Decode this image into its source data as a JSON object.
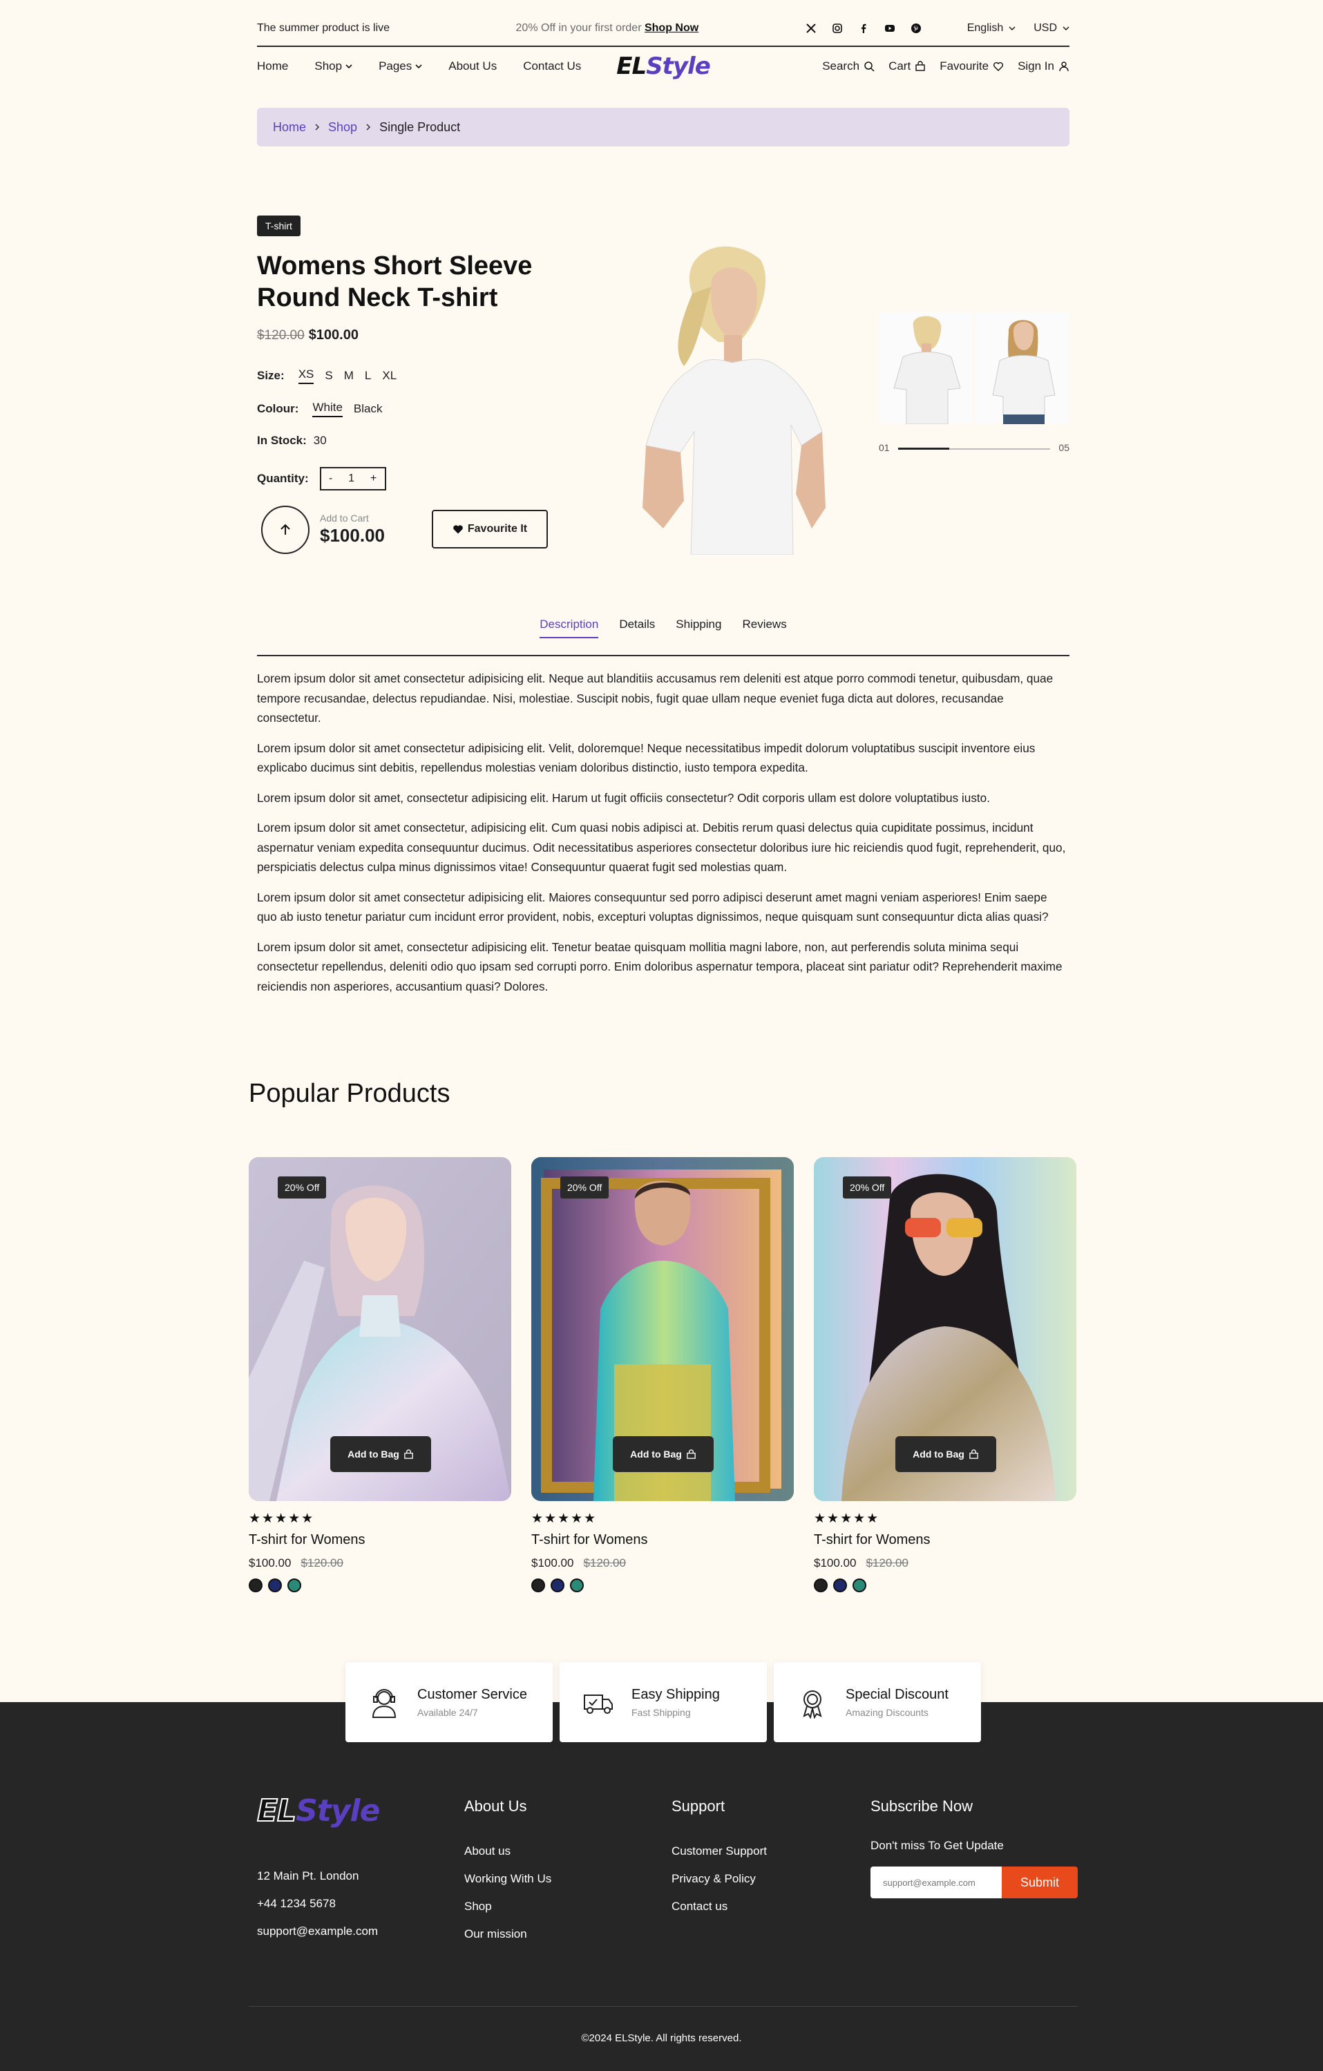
{
  "topbar": {
    "message": "The summer product is live",
    "promo_text": "20% Off in your first order",
    "promo_link": "Shop Now",
    "language": "English",
    "currency": "USD",
    "socials": [
      "x-icon",
      "instagram-icon",
      "facebook-icon",
      "youtube-icon",
      "pinterest-icon"
    ]
  },
  "nav": {
    "items": [
      "Home",
      "Shop",
      "Pages",
      "About Us",
      "Contact Us"
    ],
    "logo_a": "EL",
    "logo_b": "Style",
    "search": "Search",
    "cart": "Cart",
    "favourite": "Favourite",
    "signin": "Sign In"
  },
  "breadcrumb": {
    "home": "Home",
    "shop": "Shop",
    "current": "Single Product"
  },
  "product": {
    "tag": "T-shirt",
    "title": "Womens Short Sleeve Round Neck T-shirt",
    "old_price": "$120.00",
    "price": "$100.00",
    "size_label": "Size:",
    "sizes": [
      "XS",
      "S",
      "M",
      "L",
      "XL"
    ],
    "colour_label": "Colour:",
    "colours": [
      "White",
      "Black"
    ],
    "stock_label": "In Stock:",
    "stock": "30",
    "quantity_label": "Quantity:",
    "quantity": "1",
    "minus": "-",
    "plus": "+",
    "add_to_cart_label": "Add to Cart",
    "add_to_cart_price": "$100.00",
    "favourite_button": "Favourite It",
    "slider_start": "01",
    "slider_end": "05",
    "slider_progress": 0.2
  },
  "tabs": [
    "Description",
    "Details",
    "Shipping",
    "Reviews"
  ],
  "description": [
    "Lorem ipsum dolor sit amet consectetur adipisicing elit. Neque aut blanditiis accusamus rem deleniti est atque porro commodi tenetur, quibusdam, quae tempore recusandae, delectus repudiandae. Nisi, molestiae. Suscipit nobis, fugit quae ullam neque eveniet fuga dicta aut dolores, recusandae consectetur.",
    "Lorem ipsum dolor sit amet consectetur adipisicing elit. Velit, doloremque! Neque necessitatibus impedit dolorum voluptatibus suscipit inventore eius explicabo ducimus sint debitis, repellendus molestias veniam doloribus distinctio, iusto tempora expedita.",
    "Lorem ipsum dolor sit amet, consectetur adipisicing elit. Harum ut fugit officiis consectetur? Odit corporis ullam est dolore voluptatibus iusto.",
    "Lorem ipsum dolor sit amet consectetur, adipisicing elit. Cum quasi nobis adipisci at. Debitis rerum quasi delectus quia cupiditate possimus, incidunt aspernatur veniam expedita consequuntur ducimus. Odit necessitatibus asperiores consectetur doloribus iure hic reiciendis quod fugit, reprehenderit, quo, perspiciatis delectus culpa minus dignissimos vitae! Consequuntur quaerat fugit sed molestias quam.",
    "Lorem ipsum dolor sit amet consectetur adipisicing elit. Maiores consequuntur sed porro adipisci deserunt amet magni veniam asperiores! Enim saepe quo ab iusto tenetur pariatur cum incidunt error provident, nobis, excepturi voluptas dignissimos, neque quisquam sunt consequuntur dicta alias quasi?",
    "Lorem ipsum dolor sit amet, consectetur adipisicing elit. Tenetur beatae quisquam mollitia magni labore, non, aut perferendis soluta minima sequi consectetur repellendus, deleniti odio quo ipsam sed corrupti porro. Enim doloribus aspernatur tempora, placeat sint pariatur odit? Reprehenderit maxime reiciendis non asperiores, accusantium quasi? Dolores."
  ],
  "popular": {
    "title": "Popular Products",
    "cards": [
      {
        "badge": "20% Off",
        "bag": "Add to Bag",
        "stars": "★★★★★",
        "name": "T-shirt for Womens",
        "price": "$100.00",
        "old": "$120.00"
      },
      {
        "badge": "20% Off",
        "bag": "Add to Bag",
        "stars": "★★★★★",
        "name": "T-shirt for Womens",
        "price": "$100.00",
        "old": "$120.00"
      },
      {
        "badge": "20% Off",
        "bag": "Add to Bag",
        "stars": "★★★★★",
        "name": "T-shirt for Womens",
        "price": "$100.00",
        "old": "$120.00"
      }
    ],
    "swatch_colors": [
      "#222222",
      "#1f2a6b",
      "#2a8a78"
    ]
  },
  "features": [
    {
      "title": "Customer Service",
      "sub": "Available 24/7",
      "icon": "headset-icon"
    },
    {
      "title": "Easy Shipping",
      "sub": "Fast Shipping",
      "icon": "truck-icon"
    },
    {
      "title": "Special Discount",
      "sub": "Amazing Discounts",
      "icon": "award-icon"
    }
  ],
  "footer": {
    "logo_a": "EL",
    "logo_b": "Style",
    "address": "12 Main Pt. London",
    "phone": "+44 1234 5678",
    "email": "support@example.com",
    "about_title": "About Us",
    "about_links": [
      "About us",
      "Working With Us",
      "Shop",
      "Our mission"
    ],
    "support_title": "Support",
    "support_links": [
      "Customer Support",
      "Privacy & Policy",
      "Contact us"
    ],
    "subscribe_title": "Subscribe Now",
    "subscribe_text": "Don't miss To Get Update",
    "subscribe_placeholder": "support@example.com",
    "subscribe_button": "Submit",
    "copyright": "©2024 ELStyle. All rights reserved."
  },
  "colors": {
    "accent": "#5a3fc1",
    "dark": "#262626",
    "cta": "#e84a1b",
    "page_bg": "#fefaf2",
    "breadcrumb_bg": "#e3dbec"
  }
}
